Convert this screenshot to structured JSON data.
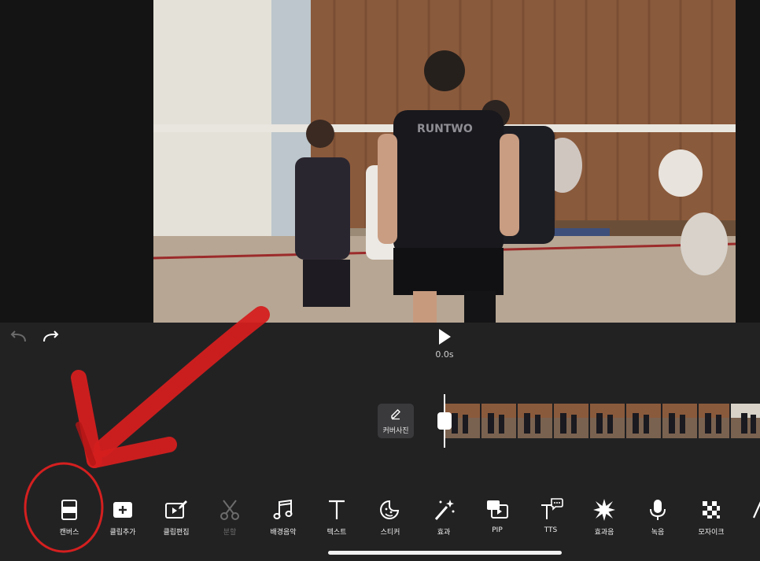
{
  "player": {
    "time": "0.0s"
  },
  "cover": {
    "label": "커버사진"
  },
  "tools": [
    {
      "id": "canvas",
      "label": "캔버스",
      "icon": "canvas-icon"
    },
    {
      "id": "add-clip",
      "label": "클립추가",
      "icon": "add-clip-icon"
    },
    {
      "id": "edit-clip",
      "label": "클립편집",
      "icon": "edit-clip-icon"
    },
    {
      "id": "split",
      "label": "분할",
      "icon": "scissors-icon",
      "disabled": true
    },
    {
      "id": "bgm",
      "label": "배경음악",
      "icon": "music-note-icon"
    },
    {
      "id": "text",
      "label": "텍스트",
      "icon": "text-icon"
    },
    {
      "id": "sticker",
      "label": "스티커",
      "icon": "sticker-icon"
    },
    {
      "id": "effect",
      "label": "효과",
      "icon": "magic-wand-icon"
    },
    {
      "id": "pip",
      "label": "PIP",
      "icon": "pip-icon"
    },
    {
      "id": "tts",
      "label": "TTS",
      "icon": "tts-icon"
    },
    {
      "id": "sound-effect",
      "label": "효과음",
      "icon": "burst-icon"
    },
    {
      "id": "record",
      "label": "녹음",
      "icon": "microphone-icon"
    },
    {
      "id": "mosaic",
      "label": "모자이크",
      "icon": "mosaic-icon"
    }
  ],
  "colors": {
    "background": "#222223",
    "annotation": "#d41f1f"
  }
}
